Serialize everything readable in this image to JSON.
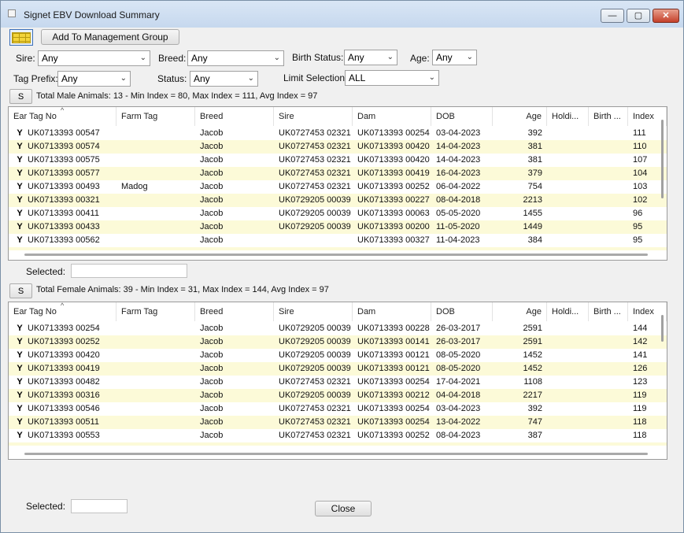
{
  "window": {
    "title": "Signet EBV Download Summary",
    "minimize_glyph": "—",
    "maximize_glyph": "▢",
    "close_glyph": "✕"
  },
  "toolbar": {
    "grid_icon": "grid-icon",
    "add_group_label": "Add To Management Group"
  },
  "filters": {
    "sire": {
      "label": "Sire:",
      "value": "Any"
    },
    "breed": {
      "label": "Breed:",
      "value": "Any"
    },
    "birth_status": {
      "label": "Birth Status:",
      "value": "Any"
    },
    "age": {
      "label": "Age:",
      "value": "Any"
    },
    "tag_prefix": {
      "label": "Tag Prefix:",
      "value": "Any"
    },
    "status": {
      "label": "Status:",
      "value": "Any"
    },
    "limit_selection": {
      "label": "Limit Selection:",
      "value": "ALL"
    }
  },
  "columns": [
    "Ear Tag No",
    "Farm Tag",
    "Breed",
    "Sire",
    "Dam",
    "DOB",
    "Age",
    "Holdi...",
    "Birth ...",
    "Index"
  ],
  "male": {
    "s_label": "S",
    "summary": "Total Male Animals: 13 - Min Index = 80, Max Index = 111, Avg Index = 97",
    "selected_label": "Selected:",
    "selected_value": "",
    "rows": [
      [
        "UK0713393 00547",
        "",
        "Jacob",
        "UK0727453 02321",
        "UK0713393 00254",
        "03-04-2023",
        "392",
        "",
        "",
        "111"
      ],
      [
        "UK0713393 00574",
        "",
        "Jacob",
        "UK0727453 02321",
        "UK0713393 00420",
        "14-04-2023",
        "381",
        "",
        "",
        "110"
      ],
      [
        "UK0713393 00575",
        "",
        "Jacob",
        "UK0727453 02321",
        "UK0713393 00420",
        "14-04-2023",
        "381",
        "",
        "",
        "107"
      ],
      [
        "UK0713393 00577",
        "",
        "Jacob",
        "UK0727453 02321",
        "UK0713393 00419",
        "16-04-2023",
        "379",
        "",
        "",
        "104"
      ],
      [
        "UK0713393 00493",
        "Madog",
        "Jacob",
        "UK0727453 02321",
        "UK0713393 00252",
        "06-04-2022",
        "754",
        "",
        "",
        "103"
      ],
      [
        "UK0713393 00321",
        "",
        "Jacob",
        "UK0729205 00039",
        "UK0713393 00227",
        "08-04-2018",
        "2213",
        "",
        "",
        "102"
      ],
      [
        "UK0713393 00411",
        "",
        "Jacob",
        "UK0729205 00039",
        "UK0713393 00063",
        "05-05-2020",
        "1455",
        "",
        "",
        "96"
      ],
      [
        "UK0713393 00433",
        "",
        "Jacob",
        "UK0729205 00039",
        "UK0713393 00200",
        "11-05-2020",
        "1449",
        "",
        "",
        "95"
      ],
      [
        "UK0713393 00562",
        "",
        "Jacob",
        "",
        "UK0713393 00327",
        "11-04-2023",
        "384",
        "",
        "",
        "95"
      ]
    ]
  },
  "female": {
    "s_label": "S",
    "summary": "Total Female Animals: 39 - Min Index = 31, Max Index = 144, Avg Index = 97",
    "selected_label": "Selected:",
    "selected_value": "",
    "rows": [
      [
        "UK0713393 00254",
        "",
        "Jacob",
        "UK0729205 00039",
        "UK0713393 00228",
        "26-03-2017",
        "2591",
        "",
        "",
        "144"
      ],
      [
        "UK0713393 00252",
        "",
        "Jacob",
        "UK0729205 00039",
        "UK0713393 00141",
        "26-03-2017",
        "2591",
        "",
        "",
        "142"
      ],
      [
        "UK0713393 00420",
        "",
        "Jacob",
        "UK0729205 00039",
        "UK0713393 00121",
        "08-05-2020",
        "1452",
        "",
        "",
        "141"
      ],
      [
        "UK0713393 00419",
        "",
        "Jacob",
        "UK0729205 00039",
        "UK0713393 00121",
        "08-05-2020",
        "1452",
        "",
        "",
        "126"
      ],
      [
        "UK0713393 00482",
        "",
        "Jacob",
        "UK0727453 02321",
        "UK0713393 00254",
        "17-04-2021",
        "1108",
        "",
        "",
        "123"
      ],
      [
        "UK0713393 00316",
        "",
        "Jacob",
        "UK0729205 00039",
        "UK0713393 00212",
        "04-04-2018",
        "2217",
        "",
        "",
        "119"
      ],
      [
        "UK0713393 00546",
        "",
        "Jacob",
        "UK0727453 02321",
        "UK0713393 00254",
        "03-04-2023",
        "392",
        "",
        "",
        "119"
      ],
      [
        "UK0713393 00511",
        "",
        "Jacob",
        "UK0727453 02321",
        "UK0713393 00254",
        "13-04-2022",
        "747",
        "",
        "",
        "118"
      ],
      [
        "UK0713393 00553",
        "",
        "Jacob",
        "UK0727453 02321",
        "UK0713393 00252",
        "08-04-2023",
        "387",
        "",
        "",
        "118"
      ]
    ]
  },
  "footer": {
    "close_label": "Close"
  },
  "colors": {
    "alt_row": "#fcfad8",
    "close_button": "#c5402a"
  }
}
